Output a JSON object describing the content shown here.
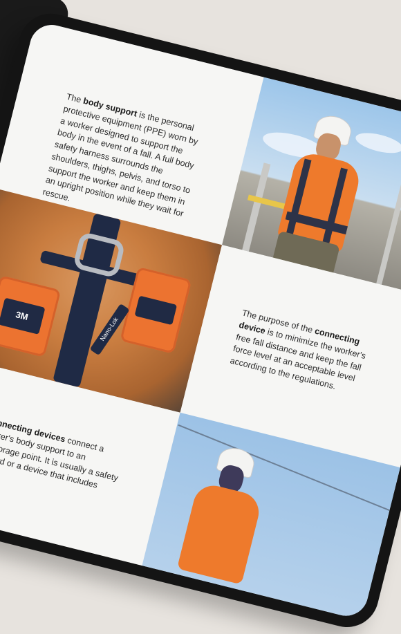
{
  "page": {
    "paragraphs": {
      "body_support": {
        "lead": "The ",
        "term": "body support",
        "rest": " is the personal protective equipment (PPE) worn by a worker designed to support the body in the event of a fall. A full body safety harness surrounds the shoulders, thighs, pelvis, and torso to support the worker and keep them in an upright position while they wait for rescue."
      },
      "connecting_device": {
        "lead": "The purpose of the ",
        "term": "connecting device",
        "rest": " is to minimize the worker's free fall distance and keep the fall force level at an acceptable level according to the regulations."
      },
      "connecting_devices": {
        "lead": "",
        "term": "Connecting devices",
        "rest": " connect a worker's body support to an anchorage point. It is usually a safety lanyard or a device that includes"
      }
    },
    "device_labels": {
      "brand_mark": "3M",
      "unit_label": "Nano-Lok"
    },
    "colors": {
      "accent_orange": "#ee7a2c",
      "strap_navy": "#1f2a45",
      "frame": "#141414"
    }
  }
}
